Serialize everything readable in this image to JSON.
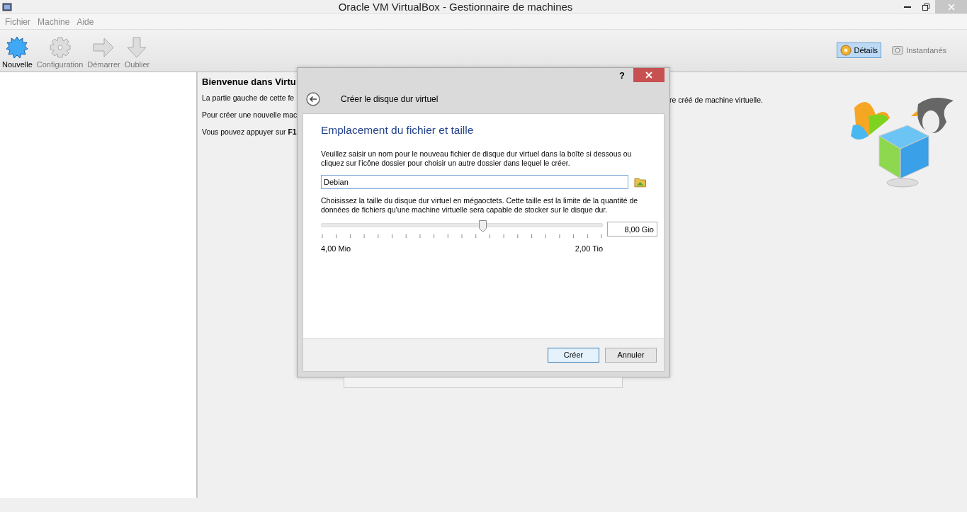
{
  "window": {
    "title": "Oracle VM VirtualBox - Gestionnaire de machines"
  },
  "menu": [
    "Fichier",
    "Machine",
    "Aide"
  ],
  "toolbar": [
    {
      "label": "Nouvelle",
      "kind": "new",
      "disabled": false
    },
    {
      "label": "Configuration",
      "kind": "settings",
      "disabled": true
    },
    {
      "label": "Démarrer",
      "kind": "start",
      "disabled": true
    },
    {
      "label": "Oublier",
      "kind": "discard",
      "disabled": true
    }
  ],
  "view_tabs": [
    {
      "label": "Détails",
      "kind": "details",
      "selected": true
    },
    {
      "label": "Instantanés",
      "kind": "snapshots",
      "selected": false
    }
  ],
  "welcome": {
    "title": "Bienvenue dans Virtu",
    "lines": [
      "La partie gauche de cette fe",
      "Pour créer une nouvelle mac",
      "Vous pouvez appuyer sur **F1**"
    ],
    "line_1_end": "re créé de machine virtuelle."
  },
  "dialog": {
    "help": "?",
    "title": "Créer le disque dur virtuel",
    "heading": "Emplacement du fichier et taille",
    "intro": "Veuillez saisir un nom pour le nouveau fichier de disque dur virtuel dans la boîte si dessous ou cliquez sur l'icône dossier pour choisir un autre dossier dans lequel le créer.",
    "file_name": "Debian",
    "size_intro": "Choisissez la taille du disque dur virtuel en mégaoctets. Cette taille est la limite de la quantité de données de fichiers qu'une machine virtuelle sera capable de stocker sur le disque dur.",
    "size": {
      "level": 0.575,
      "value": "8,00 Gio",
      "min_label": "4,00 Mio",
      "max_label": "2,00 Tio"
    },
    "buttons": [
      {
        "label": "Créer",
        "default": true
      },
      {
        "label": "Annuler",
        "default": false
      }
    ]
  }
}
